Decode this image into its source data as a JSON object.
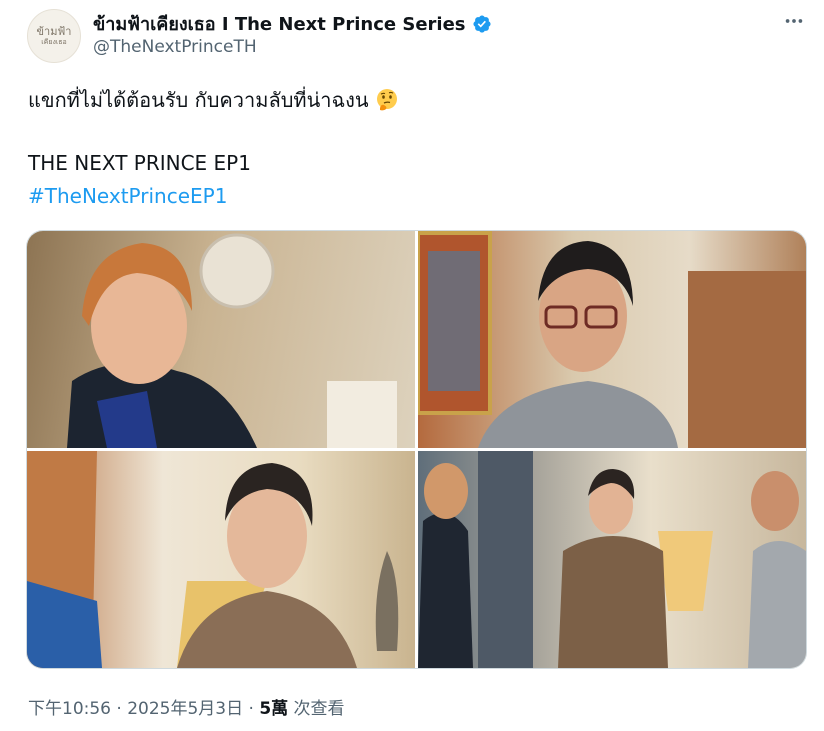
{
  "account": {
    "display_name": "ข้ามฟ้าเคียงเธอ I The Next Prince Series",
    "handle": "@TheNextPrinceTH",
    "avatar_text_line1": "ข้ามฟ้า",
    "avatar_text_line2": "เคียงเธอ",
    "verified": true
  },
  "post": {
    "line1": "แขกที่ไม่ได้ต้อนรับ กับความลับที่น่าฉงน",
    "line1_emoji": "thinking-face",
    "line2": "THE NEXT PRINCE EP1",
    "hashtag": "#TheNextPrinceEP1"
  },
  "media": {
    "photos": [
      {
        "subject": "young man with orange hair, surprised expression"
      },
      {
        "subject": "older man with glasses in grey polo"
      },
      {
        "subject": "young man in brown jacket"
      },
      {
        "subject": "three men standing in living room"
      }
    ]
  },
  "meta": {
    "timestamp": "下午10:56 · 2025年5月3日 · ",
    "views_count": "5萬",
    "views_label": " 次查看"
  },
  "colors": {
    "accent": "#1d9bf0",
    "secondary_text": "#536471",
    "text": "#0f1419"
  },
  "icons": {
    "more": "more-horizontal-icon",
    "verified": "verified-badge-icon"
  }
}
